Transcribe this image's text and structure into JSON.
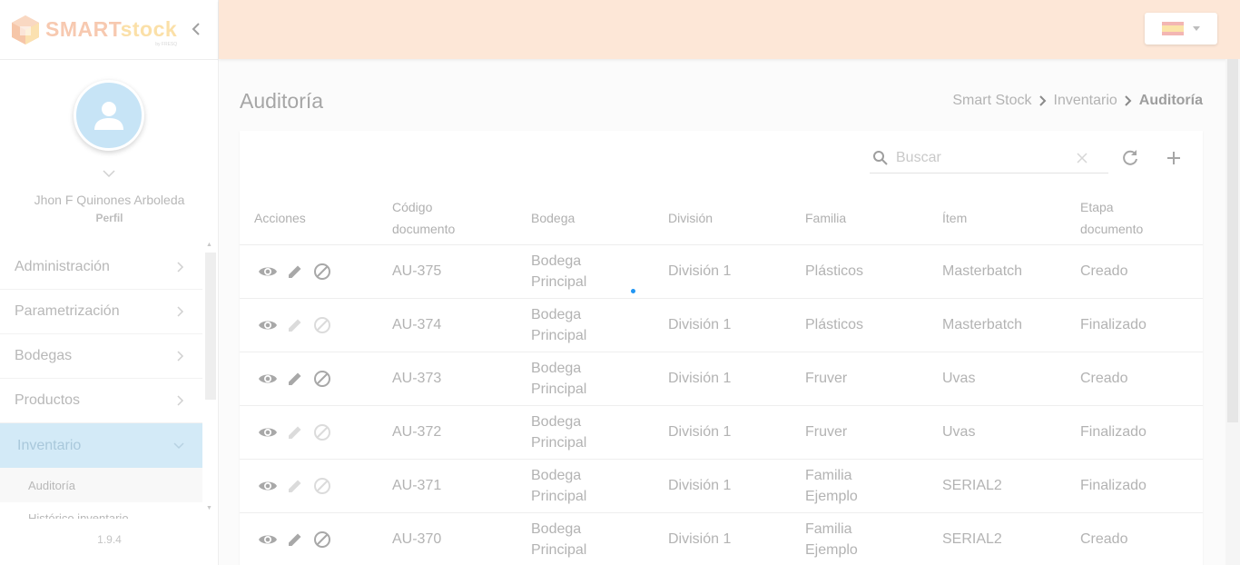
{
  "brand": {
    "part1": "SMART",
    "part2": "stock",
    "sub": "by FRESQ",
    "colors": {
      "orange": "#f2a57a",
      "yellow": "#f7c873"
    }
  },
  "sidebar": {
    "collapse_icon": "chevron-left-icon",
    "user": {
      "name": "Jhon F Quinones Arboleda",
      "role": "Perfil"
    },
    "menu": [
      {
        "label": "Administración",
        "expanded": false
      },
      {
        "label": "Parametrización",
        "expanded": false
      },
      {
        "label": "Bodegas",
        "expanded": false
      },
      {
        "label": "Productos",
        "expanded": false
      },
      {
        "label": "Inventario",
        "expanded": true
      }
    ],
    "submenu": [
      {
        "label": "Auditoría"
      },
      {
        "label": "Histórico inventario"
      }
    ],
    "version": "1.9.4"
  },
  "topbar": {
    "language": "es",
    "background": "#fde7d7"
  },
  "page": {
    "title": "Auditoría",
    "breadcrumb": [
      "Smart Stock",
      "Inventario",
      "Auditoría"
    ]
  },
  "search": {
    "placeholder": "Buscar",
    "value": ""
  },
  "table": {
    "columns": [
      "Acciones",
      "Código documento",
      "Bodega",
      "División",
      "Familia",
      "Ítem",
      "Etapa documento"
    ],
    "rows": [
      {
        "code": "AU-375",
        "warehouse": "Bodega Principal",
        "division": "División 1",
        "family": "Plásticos",
        "item": "Masterbatch",
        "stage": "Creado",
        "editable": true
      },
      {
        "code": "AU-374",
        "warehouse": "Bodega Principal",
        "division": "División 1",
        "family": "Plásticos",
        "item": "Masterbatch",
        "stage": "Finalizado",
        "editable": false
      },
      {
        "code": "AU-373",
        "warehouse": "Bodega Principal",
        "division": "División 1",
        "family": "Fruver",
        "item": "Uvas",
        "stage": "Creado",
        "editable": true
      },
      {
        "code": "AU-372",
        "warehouse": "Bodega Principal",
        "division": "División 1",
        "family": "Fruver",
        "item": "Uvas",
        "stage": "Finalizado",
        "editable": false
      },
      {
        "code": "AU-371",
        "warehouse": "Bodega Principal",
        "division": "División 1",
        "family": "Familia Ejemplo",
        "item": "SERIAL2",
        "stage": "Finalizado",
        "editable": false
      },
      {
        "code": "AU-370",
        "warehouse": "Bodega Principal",
        "division": "División 1",
        "family": "Familia Ejemplo",
        "item": "SERIAL2",
        "stage": "Creado",
        "editable": true
      }
    ]
  }
}
